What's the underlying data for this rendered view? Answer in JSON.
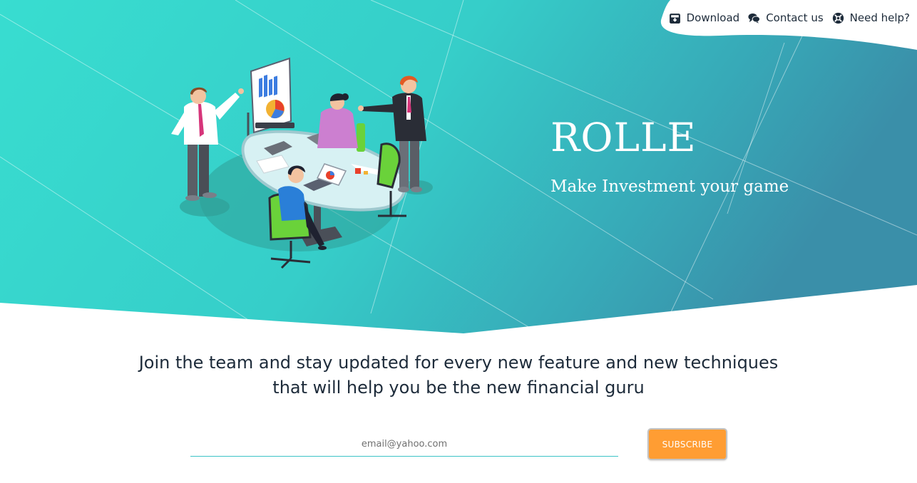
{
  "nav": {
    "download_label": "Download",
    "contact_label": "Contact us",
    "help_label": "Need help?",
    "icons": [
      "download-icon",
      "chat-bubbles-icon",
      "lifebuoy-icon"
    ]
  },
  "hero": {
    "title": "ROLLE",
    "tagline": "Make Investment your game",
    "illustration": "team-meeting-illustration"
  },
  "join": {
    "line1": "Join the team and stay updated for every new feature and new techniques",
    "line2": "that will help you be the new financial guru"
  },
  "subscribe": {
    "email_placeholder": "email@yahoo.com",
    "button_label": "SUBSCRIBE"
  },
  "colors": {
    "hero_start": "#3be0d2",
    "hero_end": "#3a8fa9",
    "text_dark": "#1d2b3a",
    "accent_orange": "#ff9d33",
    "input_underline": "#3cc3c7"
  }
}
